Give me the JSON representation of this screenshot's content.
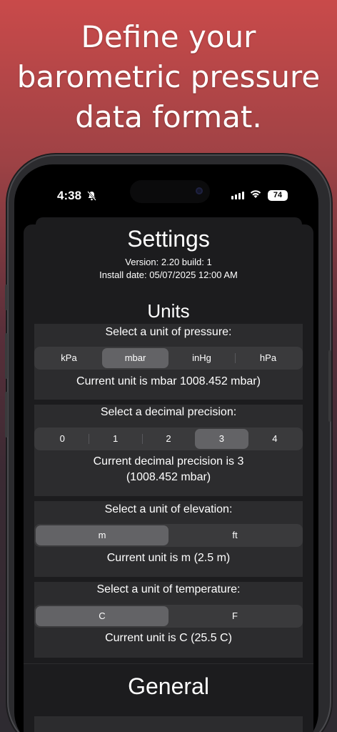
{
  "promo": {
    "headline_lines": [
      "Define your",
      "barometric pressure",
      "data format."
    ]
  },
  "status_bar": {
    "time": "4:38",
    "battery": "74"
  },
  "settings": {
    "title": "Settings",
    "version": "Version: 2.20 build: 1",
    "install_date": "Install date: 05/07/2025 12:00 AM",
    "units_title": "Units",
    "pressure": {
      "label": "Select a unit of pressure:",
      "options": [
        "kPa",
        "mbar",
        "inHg",
        "hPa"
      ],
      "selected": "mbar",
      "current": "Current unit is mbar 1008.452 mbar)"
    },
    "precision": {
      "label": "Select a decimal precision:",
      "options": [
        "0",
        "1",
        "2",
        "3",
        "4"
      ],
      "selected": "3",
      "current_line1": "Current decimal precision is 3",
      "current_line2": "(1008.452 mbar)"
    },
    "elevation": {
      "label": "Select a unit of elevation:",
      "options": [
        "m",
        "ft"
      ],
      "selected": "m",
      "current": "Current unit is m (2.5 m)"
    },
    "temperature": {
      "label": "Select a unit of temperature:",
      "options": [
        "C",
        "F"
      ],
      "selected": "C",
      "current": "Current unit is C (25.5 C)"
    },
    "general_title": "General"
  }
}
